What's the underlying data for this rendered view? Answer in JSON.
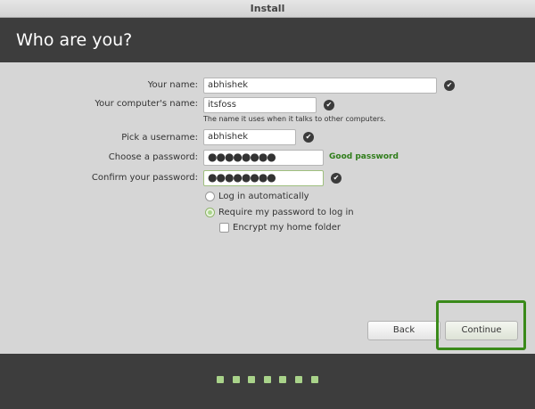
{
  "window": {
    "title": "Install"
  },
  "header": {
    "title": "Who are you?"
  },
  "form": {
    "your_name": {
      "label": "Your name:",
      "value": "abhishek"
    },
    "computer_name": {
      "label": "Your computer's name:",
      "value": "itsfoss",
      "hint": "The name it uses when it talks to other computers."
    },
    "username": {
      "label": "Pick a username:",
      "value": "abhishek"
    },
    "password": {
      "label": "Choose a password:",
      "value": "●●●●●●●●",
      "strength": "Good password"
    },
    "confirm_password": {
      "label": "Confirm your password:",
      "value": "●●●●●●●●"
    },
    "login_auto": {
      "label": "Log in automatically",
      "selected": false
    },
    "require_password": {
      "label": "Require my password to log in",
      "selected": true
    },
    "encrypt_home": {
      "label": "Encrypt my home folder",
      "checked": false
    }
  },
  "buttons": {
    "back": "Back",
    "continue": "Continue"
  },
  "progress": {
    "steps": 7
  },
  "colors": {
    "accent": "#3a8a1a",
    "good": "#2f7d1a",
    "dots": "#a9d38a"
  }
}
